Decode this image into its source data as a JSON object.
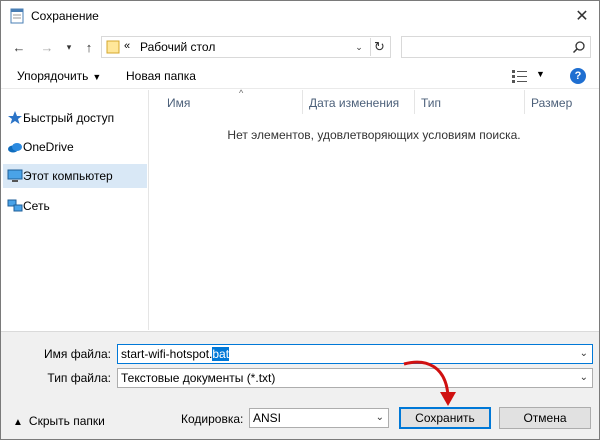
{
  "window": {
    "title": "Сохранение"
  },
  "nav": {
    "address_chevrons": "«",
    "address_path": "Рабочий стол",
    "search_placeholder": ""
  },
  "toolbar": {
    "organize_label": "Упорядочить",
    "new_folder_label": "Новая папка",
    "help_label": "?"
  },
  "sidebar": {
    "items": [
      {
        "label": "Быстрый доступ",
        "icon": "star-icon",
        "selected": false
      },
      {
        "label": "OneDrive",
        "icon": "cloud-icon",
        "selected": false
      },
      {
        "label": "Этот компьютер",
        "icon": "computer-icon",
        "selected": true
      },
      {
        "label": "Сеть",
        "icon": "network-icon",
        "selected": false
      }
    ]
  },
  "content": {
    "columns": [
      "Имя",
      "Дата изменения",
      "Тип",
      "Размер"
    ],
    "empty_message": "Нет элементов, удовлетворяющих условиям поиска."
  },
  "bottom": {
    "filename_label": "Имя файла:",
    "filename_base": "start-wifi-hotspot.",
    "filename_ext_selected": "bat",
    "filetype_label": "Тип файла:",
    "filetype_value": "Текстовые документы (*.txt)",
    "hide_folders_label": "Скрыть папки",
    "encoding_label": "Кодировка:",
    "encoding_value": "ANSI",
    "save_label": "Сохранить",
    "cancel_label": "Отмена"
  },
  "colors": {
    "accent": "#0078d7",
    "selection_bg": "#d9e8f6",
    "annotation_arrow": "#d01010"
  }
}
